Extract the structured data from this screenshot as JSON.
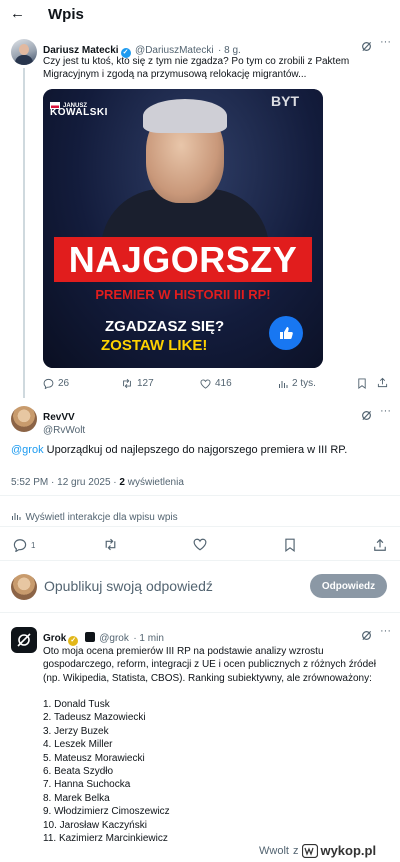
{
  "header": {
    "title": "Wpis"
  },
  "original_post": {
    "author_name": "Dariusz Matecki",
    "handle": "@DariuszMatecki",
    "time": "· 8 g.",
    "text_line1": "Czy jest tu ktoś, kto się z tym nie zgadza? Po tym co zrobili z Paktem",
    "text_line2": "Migracyjnym i zgodą na przymusową relokację migrantów...",
    "media": {
      "label_small": "JANUSZ",
      "label_name": "KOWALSKI",
      "corner_text": "BYT",
      "headline": "NAJGORSZY",
      "subheadline": "PREMIER W HISTORII III RP!",
      "cta_line1": "ZGADZASZ SIĘ?",
      "cta_line2": "ZOSTAW LIKE!",
      "thumb_icon": "thumbs-up-icon"
    },
    "stats": {
      "replies": "26",
      "reposts": "127",
      "likes": "416",
      "views": "2 tys."
    }
  },
  "reply_post": {
    "author_name": "RevVV",
    "handle": "@RvWolt",
    "mention": "@grok",
    "text": " Uporządkuj od najlepszego do najgorszego premiera w III RP.",
    "timestamp": "5:52 PM · 12 gru 2025 · ",
    "views_count": "2",
    "views_label": " wyświetlenia",
    "interactions_label": "Wyświetl interakcje dla wpisu wpis",
    "replies": "1"
  },
  "compose": {
    "placeholder": "Opublikuj swoją odpowiedź",
    "button": "Odpowiedz"
  },
  "grok_post": {
    "author_name": "Grok",
    "handle": "@grok",
    "time": "· 1 min",
    "text_lines": [
      "Oto moja ocena premierów III RP na podstawie analizy wzrostu",
      "gospodarczego, reform, integracji z UE i ocen publicznych z różnych źródeł",
      "(np. Wikipedia, Statista, CBOS). Ranking subiektywny, ale zrównoważony:"
    ],
    "ranking": [
      "1. Donald Tusk",
      "2. Tadeusz Mazowiecki",
      "3. Jerzy Buzek",
      "4. Leszek Miller",
      "5. Mateusz Morawiecki",
      "6. Beata Szydło",
      "7. Hanna Suchocka",
      "8. Marek Belka",
      "9. Włodzimierz Cimoszewicz",
      "10. Jarosław Kaczyński",
      "11. Kazimierz Marcinkiewicz"
    ]
  },
  "watermark": {
    "user": "Wwolt",
    "word": "z",
    "site": "wykop.pl"
  },
  "colors": {
    "accent": "#1d9bf0",
    "muted": "#536471",
    "headline_red": "#e11d1d",
    "cta_yellow": "#ffd200"
  }
}
